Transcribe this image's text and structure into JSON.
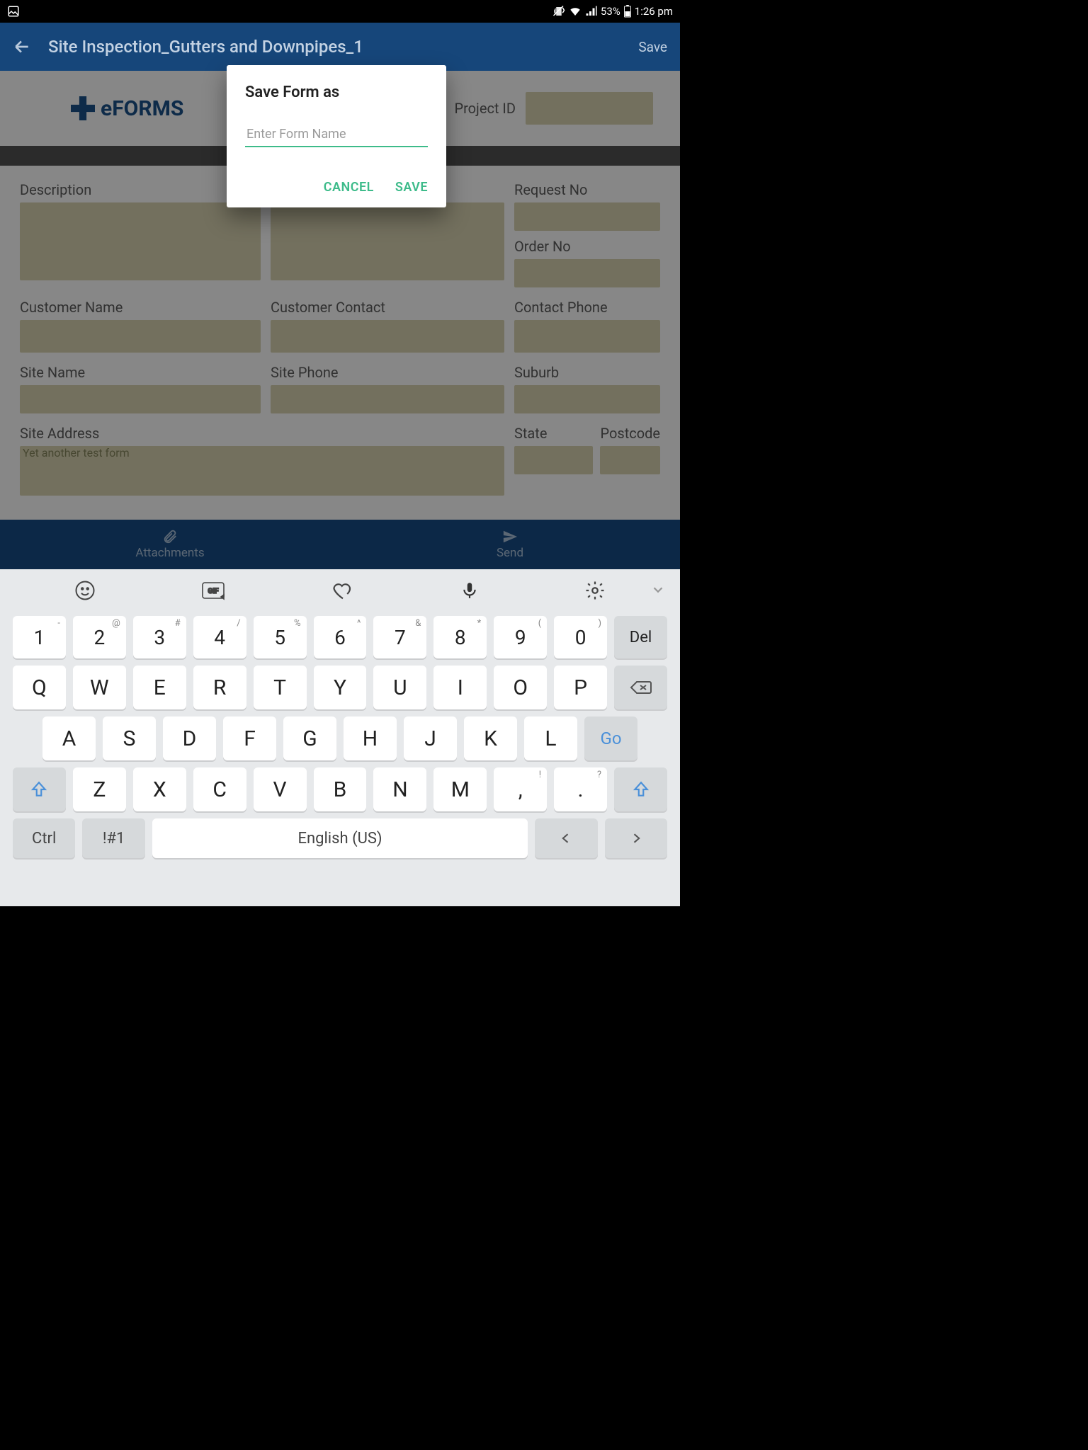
{
  "status": {
    "battery": "53%",
    "time": "1:26 pm"
  },
  "appbar": {
    "title": "Site Inspection_Gutters and Downpipes_1",
    "save": "Save"
  },
  "logo": {
    "text": "eFORMS"
  },
  "projectid": {
    "label": "Project ID"
  },
  "fields": {
    "description": "Description",
    "request_no": "Request No",
    "order_no": "Order No",
    "customer_name": "Customer Name",
    "customer_contact": "Customer Contact",
    "contact_phone": "Contact Phone",
    "site_name": "Site Name",
    "site_phone": "Site Phone",
    "suburb": "Suburb",
    "site_address": "Site Address",
    "state": "State",
    "postcode": "Postcode",
    "site_address_value": "Yet another test form"
  },
  "actions": {
    "attachments": "Attachments",
    "send": "Send"
  },
  "dialog": {
    "title": "Save Form as",
    "placeholder": "Enter Form Name",
    "cancel": "CANCEL",
    "save": "SAVE"
  },
  "keyboard": {
    "row1": [
      {
        "k": "1",
        "s": "‑"
      },
      {
        "k": "2",
        "s": "@"
      },
      {
        "k": "3",
        "s": "#"
      },
      {
        "k": "4",
        "s": "/"
      },
      {
        "k": "5",
        "s": "%"
      },
      {
        "k": "6",
        "s": "^"
      },
      {
        "k": "7",
        "s": "&"
      },
      {
        "k": "8",
        "s": "*"
      },
      {
        "k": "9",
        "s": "("
      },
      {
        "k": "0",
        "s": ")"
      }
    ],
    "del": "Del",
    "row2": [
      "Q",
      "W",
      "E",
      "R",
      "T",
      "Y",
      "U",
      "I",
      "O",
      "P"
    ],
    "row3": [
      "A",
      "S",
      "D",
      "F",
      "G",
      "H",
      "J",
      "K",
      "L"
    ],
    "go": "Go",
    "row4": [
      "Z",
      "X",
      "C",
      "V",
      "B",
      "N",
      "M"
    ],
    "comma_sup": "!",
    "period_sup": "?",
    "ctrl": "Ctrl",
    "sym": "!#1",
    "space": "English (US)"
  }
}
